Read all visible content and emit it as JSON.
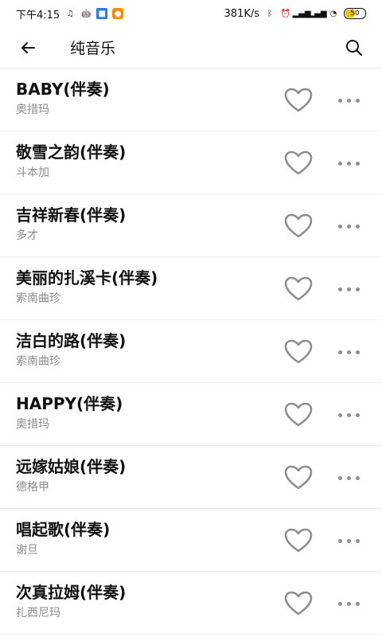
{
  "status_bar": {
    "time": "下午4:15",
    "network_speed": "381K/s",
    "battery": "50",
    "icons": [
      "music-note-icon",
      "android-icon",
      "app-blue-icon",
      "app-orange-icon",
      "bluetooth-icon",
      "alarm-icon",
      "signal-icon",
      "signal-icon-2",
      "wifi-icon",
      "battery-icon"
    ]
  },
  "header": {
    "title": "纯音乐",
    "back_icon": "arrow-left-icon",
    "search_icon": "search-icon"
  },
  "songs": [
    {
      "title": "BABY(伴奏)",
      "artist": "奥措玛"
    },
    {
      "title": "敬雪之韵(伴奏)",
      "artist": "斗本加"
    },
    {
      "title": "吉祥新春(伴奏)",
      "artist": "多才"
    },
    {
      "title": "美丽的扎溪卡(伴奏)",
      "artist": "索南曲珍"
    },
    {
      "title": "洁白的路(伴奏)",
      "artist": "索南曲珍"
    },
    {
      "title": "HAPPY(伴奏)",
      "artist": "奥措玛"
    },
    {
      "title": "远嫁姑娘(伴奏)",
      "artist": "德格甲"
    },
    {
      "title": "唱起歌(伴奏)",
      "artist": "谢旦"
    },
    {
      "title": "次真拉姆(伴奏)",
      "artist": "扎西尼玛"
    }
  ],
  "colors": {
    "background": "#ffffff",
    "text_primary": "#111111",
    "text_secondary": "#8a8a8a",
    "icon_gray": "#8d8d8d"
  }
}
